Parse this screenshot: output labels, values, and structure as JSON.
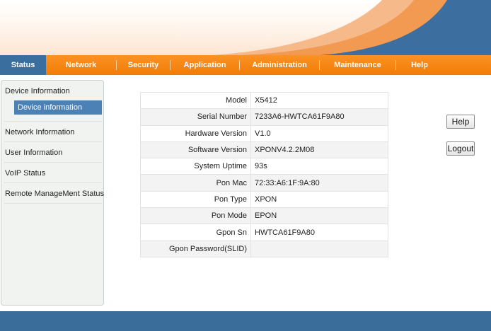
{
  "nav": {
    "tabs": [
      {
        "label": "Status",
        "active": true
      },
      {
        "label": "Network",
        "active": false
      },
      {
        "label": "Security",
        "active": false
      },
      {
        "label": "Application",
        "active": false
      },
      {
        "label": "Administration",
        "active": false
      },
      {
        "label": "Maintenance",
        "active": false
      },
      {
        "label": "Help",
        "active": false
      }
    ]
  },
  "sidebar": {
    "sections": [
      {
        "label": "Device Information",
        "sub": [
          {
            "label": "Device information",
            "selected": true
          }
        ]
      },
      {
        "label": "Network Information"
      },
      {
        "label": "User Information"
      },
      {
        "label": "VoIP Status"
      },
      {
        "label": "Remote ManageMent Status"
      }
    ]
  },
  "device_info": {
    "rows": [
      {
        "key": "Model",
        "value": "X5412"
      },
      {
        "key": "Serial Number",
        "value": "7233A6-HWTCA61F9A80"
      },
      {
        "key": "Hardware Version",
        "value": "V1.0"
      },
      {
        "key": "Software Version",
        "value": "XPONV4.2.2M08"
      },
      {
        "key": "System Uptime",
        "value": "93s"
      },
      {
        "key": "Pon Mac",
        "value": "72:33:A6:1F:9A:80"
      },
      {
        "key": "Pon Type",
        "value": "XPON"
      },
      {
        "key": "Pon Mode",
        "value": "EPON"
      },
      {
        "key": "Gpon Sn",
        "value": "HWTCA61F9A80"
      },
      {
        "key": "Gpon Password(SLID)",
        "value": ""
      }
    ]
  },
  "buttons": {
    "help": "Help",
    "logout": "Logout"
  },
  "colors": {
    "nav_orange": "#f58510",
    "nav_active": "#3a6e9e",
    "banner_blue": "#3c6fa0",
    "sidebar_selected": "#4b81b5",
    "footer": "#3b6d9a"
  }
}
